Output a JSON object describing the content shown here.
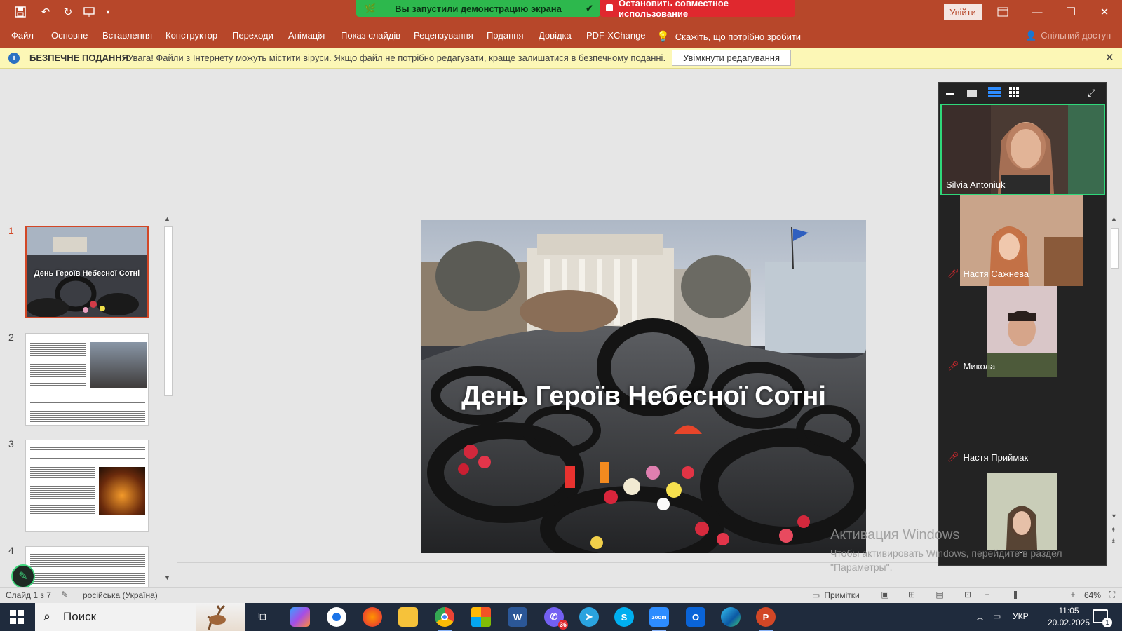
{
  "window": {
    "share_banner": "Вы запустили демонстрацию экрана",
    "stop_share": "Остановить совместное использование",
    "signin": "Увійти"
  },
  "menu": {
    "items": [
      "Файл",
      "Основне",
      "Вставлення",
      "Конструктор",
      "Переходи",
      "Анімація",
      "Показ слайдів",
      "Рецензування",
      "Подання",
      "Довідка",
      "PDF-XChange"
    ],
    "tell_me": "Скажіть, що потрібно зробити",
    "coauth": "Спільний доступ"
  },
  "protected_view": {
    "title": "БЕЗПЕЧНЕ ПОДАННЯ",
    "message": "Увага! Файли з Інтернету можуть містити віруси. Якщо файл не потрібно редагувати, краще залишатися в безпечному поданні.",
    "button": "Увімкнути редагування"
  },
  "slides": {
    "numbers": [
      "1",
      "2",
      "3",
      "4"
    ],
    "thumb1_title": "День Героїв Небесної Сотні",
    "current_title": "День Героїв Небесної Сотні",
    "current": 1
  },
  "zoom": {
    "participants": [
      {
        "name": "Silvia Antoniuk",
        "muted": false
      },
      {
        "name": "Настя Сажнева",
        "muted": true
      },
      {
        "name": "Микола",
        "muted": true
      },
      {
        "name": "Настя Приймак",
        "muted": true
      }
    ]
  },
  "watermark": {
    "title": "Активация Windows",
    "line1": "Чтобы активировать Windows, перейдите в раздел",
    "line2": "\"Параметры\"."
  },
  "status": {
    "slide_of": "Слайд 1 з 7",
    "language": "російська (Україна)",
    "notes": "Примітки",
    "zoom_percent": "64%",
    "zoom_value": 0.64
  },
  "taskbar": {
    "search": "Поиск",
    "viber_badge": "36",
    "language": "УКР",
    "time": "11:05",
    "date": "20.02.2025",
    "notifications": "1"
  }
}
